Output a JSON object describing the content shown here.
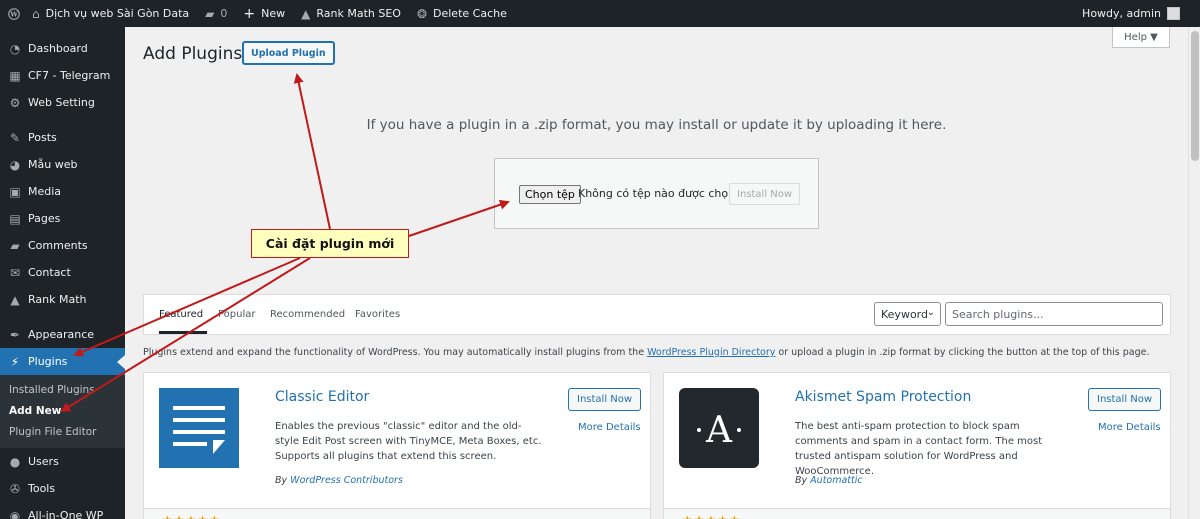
{
  "adminbar": {
    "site_name": "Dịch vụ web Sài Gòn Data",
    "comments_count": "0",
    "new_label": "New",
    "rankmath_label": "Rank Math SEO",
    "delete_cache_label": "Delete Cache",
    "howdy": "Howdy, admin"
  },
  "sidebar": {
    "items": [
      {
        "label": "Dashboard",
        "icon": "dashboard-icon",
        "glyph": "◔"
      },
      {
        "label": "CF7 - Telegram",
        "icon": "grid-icon",
        "glyph": "▦"
      },
      {
        "label": "Web Setting",
        "icon": "gear-icon",
        "glyph": "⚙"
      },
      {
        "label": "Posts",
        "icon": "pin-icon",
        "glyph": "✎"
      },
      {
        "label": "Mẫu web",
        "icon": "palette-icon",
        "glyph": "◕"
      },
      {
        "label": "Media",
        "icon": "media-icon",
        "glyph": "▣"
      },
      {
        "label": "Pages",
        "icon": "pages-icon",
        "glyph": "▤"
      },
      {
        "label": "Comments",
        "icon": "comment-icon",
        "glyph": "▰"
      },
      {
        "label": "Contact",
        "icon": "mail-icon",
        "glyph": "✉"
      },
      {
        "label": "Rank Math",
        "icon": "chart-icon",
        "glyph": "▲"
      },
      {
        "label": "Appearance",
        "icon": "brush-icon",
        "glyph": "✒"
      },
      {
        "label": "Plugins",
        "icon": "plugin-icon",
        "glyph": "⚡"
      },
      {
        "label": "Users",
        "icon": "user-icon",
        "glyph": "●"
      },
      {
        "label": "Tools",
        "icon": "wrench-icon",
        "glyph": "✇"
      },
      {
        "label": "All-in-One WP",
        "icon": "migration-icon",
        "glyph": "◉"
      }
    ],
    "submenu": [
      "Installed Plugins",
      "Add New",
      "Plugin File Editor"
    ]
  },
  "main": {
    "title": "Add Plugins",
    "upload_button": "Upload Plugin",
    "help": "Help ▼",
    "upload_message": "If you have a plugin in a .zip format, you may install or update it by uploading it here.",
    "choose_file": "Chọn tệp",
    "no_file": "Không có tệp nào được chọn",
    "install_now": "Install Now"
  },
  "filter": {
    "tabs": [
      "Featured",
      "Popular",
      "Recommended",
      "Favorites"
    ],
    "keyword": "Keyword",
    "search_placeholder": "Search plugins..."
  },
  "intro": {
    "before": "Plugins extend and expand the functionality of WordPress. You may automatically install plugins from the ",
    "link": "WordPress Plugin Directory",
    "after": " or upload a plugin in .zip format by clicking the button at the top of this page."
  },
  "cards": [
    {
      "name": "Classic Editor",
      "description": "Enables the previous \"classic\" editor and the old-style Edit Post screen with TinyMCE, Meta Boxes, etc. Supports all plugins that extend this screen.",
      "by_prefix": "By ",
      "author": "WordPress Contributors",
      "install": "Install Now",
      "more": "More Details"
    },
    {
      "name": "Akismet Spam Protection",
      "description": "The best anti-spam protection to block spam comments and spam in a contact form. The most trusted antispam solution for WordPress and WooCommerce.",
      "by_prefix": "By ",
      "author": "Automattic",
      "install": "Install Now",
      "more": "More Details"
    }
  ],
  "callout": "Cài đặt plugin mới",
  "colors": {
    "admin_dark": "#1d2327",
    "accent": "#2271b1",
    "annotation_red": "#c01a1a",
    "callout_bg": "#ffffbe"
  }
}
